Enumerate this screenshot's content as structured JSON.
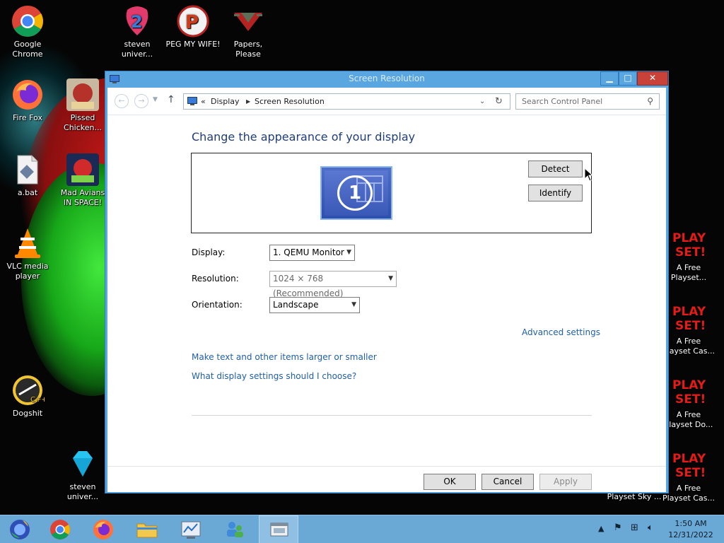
{
  "desktop": {
    "icons": [
      {
        "label": "Google\nChrome"
      },
      {
        "label": "steven\nuniver..."
      },
      {
        "label": "PEG MY WIFE!"
      },
      {
        "label": "Papers,\nPlease"
      },
      {
        "label": "Fire Fox"
      },
      {
        "label": "Pissed\nChicken..."
      },
      {
        "label": "a.bat"
      },
      {
        "label": "Mad Avians\nIN SPACE!"
      },
      {
        "label": "VLC media\nplayer"
      },
      {
        "label": "Dogshit"
      },
      {
        "label": "steven\nuniver..."
      },
      {
        "label": "A Free\nPlayset..."
      },
      {
        "label": "A Free\nPlayset Cas..."
      },
      {
        "label": "A Free\nPlayset Do..."
      },
      {
        "label": "A Free\nPlayset Cas..."
      },
      {
        "label": "Playset Sky ..."
      }
    ]
  },
  "window": {
    "title": "Screen Resolution",
    "controls": {
      "minimize": "▁",
      "maximize": "□",
      "close": "✕"
    },
    "address": {
      "prefix": "«",
      "crumbs": [
        "Display",
        "Screen Resolution"
      ]
    },
    "search_placeholder": "Search Control Panel",
    "heading": "Change the appearance of your display",
    "monitor_number": "1",
    "detect_label": "Detect",
    "identify_label": "Identify",
    "form": {
      "display_label": "Display:",
      "display_value": "1. QEMU Monitor",
      "resolution_label": "Resolution:",
      "resolution_value": "1024 × 768 (Recommended)",
      "orientation_label": "Orientation:",
      "orientation_value": "Landscape"
    },
    "advanced_link": "Advanced settings",
    "links": [
      "Make text and other items larger or smaller",
      "What display settings should I choose?"
    ],
    "buttons": {
      "ok": "OK",
      "cancel": "Cancel",
      "apply": "Apply"
    }
  },
  "taskbar": {
    "items": [
      "start",
      "chrome",
      "firefox",
      "file-explorer",
      "control-panel",
      "network-users",
      "screen-resolution"
    ],
    "time": "1:50 AM",
    "date": "12/31/2022"
  },
  "colors": {
    "heading": "#1e3d7b",
    "link": "#1f5fa8",
    "window_border": "#5aa6e0",
    "close_button": "#c9423a",
    "taskbar": "#6aa8d6"
  }
}
